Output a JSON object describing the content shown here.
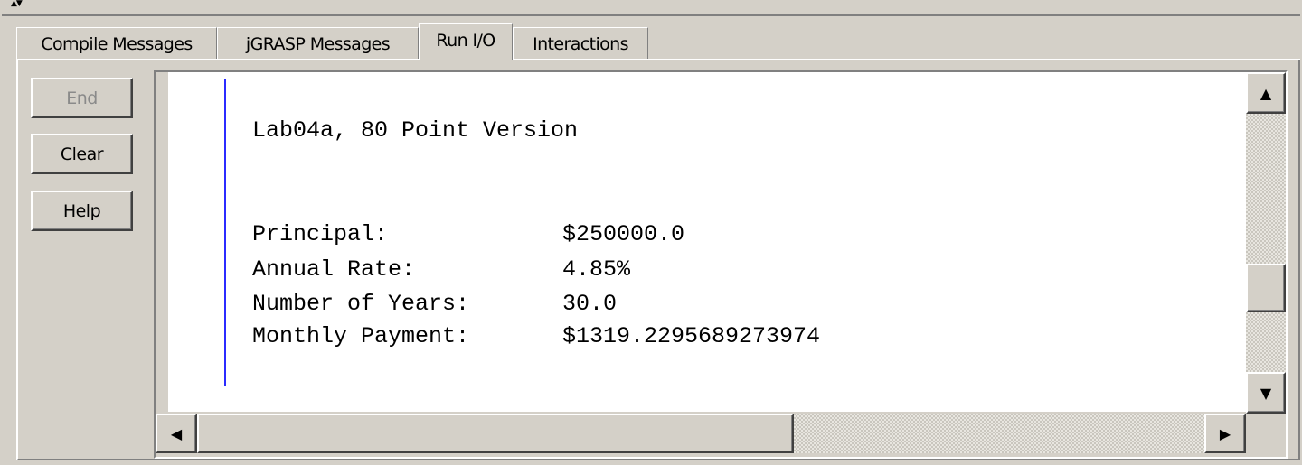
{
  "tabs": [
    {
      "label": "Compile Messages",
      "active": false
    },
    {
      "label": "jGRASP Messages",
      "active": false
    },
    {
      "label": "Run I/O",
      "active": true
    },
    {
      "label": "Interactions",
      "active": false
    }
  ],
  "sidebar": {
    "end_label": "End",
    "end_enabled": false,
    "clear_label": "Clear",
    "help_label": "Help"
  },
  "output": {
    "title_line": "Lab04a, 80 Point Version",
    "rows": [
      {
        "label": "Principal:",
        "value": "$250000.0"
      },
      {
        "label": "Annual Rate:",
        "value": "4.85%"
      },
      {
        "label": "Number of Years:",
        "value": "30.0"
      },
      {
        "label": "Monthly Payment:",
        "value": "$1319.2295689273974"
      }
    ]
  },
  "icons": {
    "splitter": "collapse-expand-arrows-icon",
    "scroll_up": "arrow-up-icon",
    "scroll_down": "arrow-down-icon",
    "scroll_left": "arrow-left-icon",
    "scroll_right": "arrow-right-icon"
  },
  "colors": {
    "chrome": "#d4d0c8",
    "cursor_line": "#2b2bff",
    "disabled_text": "#8a8a8a"
  }
}
